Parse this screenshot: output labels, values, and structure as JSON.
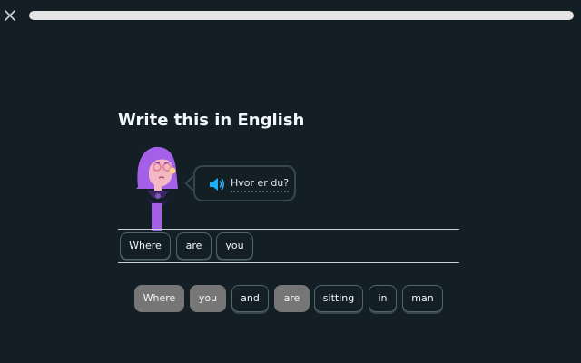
{
  "header": {
    "progress_fraction": 1.0,
    "close_icon": "close-icon"
  },
  "challenge": {
    "title": "Write this in English",
    "prompt_text": "Hvor er du?",
    "speaker_icon": "speaker-icon"
  },
  "answer": {
    "words": [
      "Where",
      "are",
      "you"
    ]
  },
  "word_bank": {
    "words": [
      {
        "label": "Where",
        "used": true
      },
      {
        "label": "you",
        "used": true
      },
      {
        "label": "and",
        "used": false
      },
      {
        "label": "are",
        "used": true
      },
      {
        "label": "sitting",
        "used": false
      },
      {
        "label": "in",
        "used": false
      },
      {
        "label": "man",
        "used": false
      }
    ]
  },
  "colors": {
    "background": "#131f24",
    "progress_fill": "#e5e5e5",
    "used_chip": "#767676",
    "speaker_blue": "#1cb0f6",
    "character_hair": "#a560e8"
  }
}
